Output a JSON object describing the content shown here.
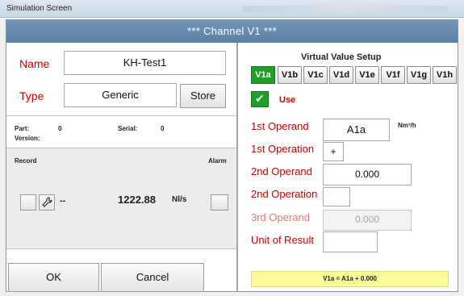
{
  "window": {
    "title": "Simulation Screen"
  },
  "header": {
    "title": "***  Channel V1  ***"
  },
  "left": {
    "name_label": "Name",
    "name_value": "KH-Test1",
    "type_label": "Type",
    "type_value": "Generic",
    "store_label": "Store",
    "part_label": "Part:",
    "part_value": "0",
    "serial_label": "Serial:",
    "serial_value": "0",
    "version_label": "Version:",
    "record_label": "Record",
    "alarm_label": "Alarm",
    "measure_dash": "--",
    "measure_value": "1222.88",
    "measure_unit": "Nl/s",
    "ok_label": "OK",
    "cancel_label": "Cancel"
  },
  "right": {
    "title": "Virtual Value Setup",
    "tabs": [
      {
        "label": "V1a",
        "active": true
      },
      {
        "label": "V1b",
        "active": false
      },
      {
        "label": "V1c",
        "active": false
      },
      {
        "label": "V1d",
        "active": false
      },
      {
        "label": "V1e",
        "active": false
      },
      {
        "label": "V1f",
        "active": false
      },
      {
        "label": "V1g",
        "active": false
      },
      {
        "label": "V1h",
        "active": false
      }
    ],
    "use_label": "Use",
    "use_checked": true,
    "operand1_label": "1st Operand",
    "operand1_value": "A1a",
    "operand1_unit": "Nm³/h",
    "operation1_label": "1st Operation",
    "operation1_value": "+",
    "operand2_label": "2nd Operand",
    "operand2_value": "0.000",
    "operation2_label": "2nd Operation",
    "operation2_value": "",
    "operand3_label": "3rd Operand",
    "operand3_value": "0.000",
    "unit_label": "Unit of Result",
    "unit_value": "",
    "formula": "V1a = A1a + 0.000"
  },
  "colors": {
    "header": "#5b7fa3",
    "label_red": "#d00000",
    "tab_active": "#1f9f2a",
    "result_bg": "#fbfb99"
  }
}
